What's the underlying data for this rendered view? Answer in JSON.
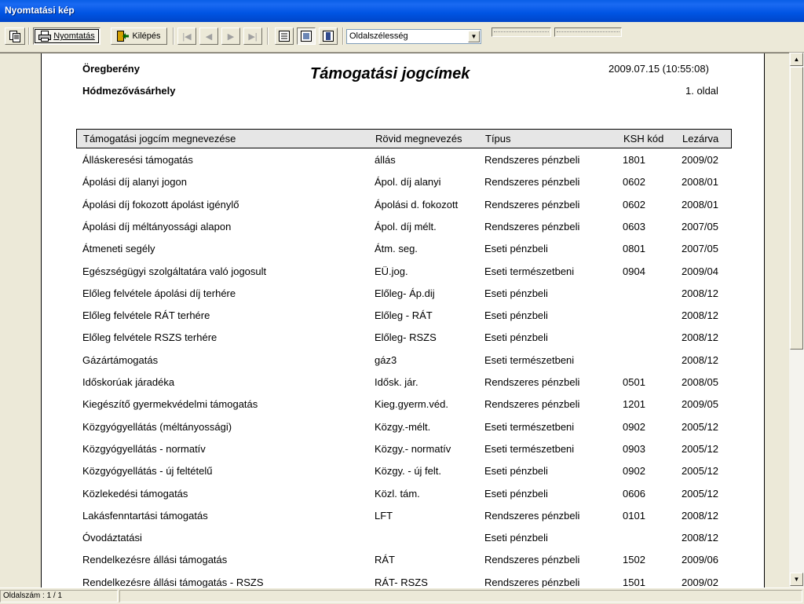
{
  "window": {
    "title": "Nyomtatási kép"
  },
  "toolbar": {
    "print_label": "Nyomtatás",
    "exit_label": "Kilépés",
    "zoom_value": "Oldalszélesség"
  },
  "report": {
    "org_line1": "Öregberény",
    "org_line2": "Hódmezővásárhely",
    "title": "Támogatási jogcímek",
    "datetime": "2009.07.15 (10:55:08)",
    "page": "1. oldal",
    "columns": [
      "Támogatási jogcím megnevezése",
      "Rövid megnevezés",
      "Típus",
      "KSH kód",
      "Lezárva"
    ],
    "rows": [
      [
        "Álláskeresési támogatás",
        "állás",
        "Rendszeres pénzbeli",
        "1801",
        "2009/02"
      ],
      [
        "Ápolási díj alanyi jogon",
        "Ápol. díj alanyi",
        "Rendszeres pénzbeli",
        "0602",
        "2008/01"
      ],
      [
        "Ápolási díj fokozott ápolást igénylő",
        "Ápolási d. fokozott",
        "Rendszeres pénzbeli",
        "0602",
        "2008/01"
      ],
      [
        "Ápolási díj méltányossági alapon",
        "Ápol. díj mélt.",
        "Rendszeres pénzbeli",
        "0603",
        "2007/05"
      ],
      [
        "Átmeneti segély",
        "Átm. seg.",
        "Eseti pénzbeli",
        "0801",
        "2007/05"
      ],
      [
        "Egészségügyi szolgáltatára való jogosult",
        "EÜ.jog.",
        "Eseti természetbeni",
        "0904",
        "2009/04"
      ],
      [
        "Előleg felvétele ápolási díj terhére",
        "Előleg- Áp.dij",
        "Eseti pénzbeli",
        "",
        "2008/12"
      ],
      [
        "Előleg felvétele RÁT terhére",
        "Előleg - RÁT",
        "Eseti pénzbeli",
        "",
        "2008/12"
      ],
      [
        "Előleg felvétele RSZS terhére",
        "Előleg- RSZS",
        "Eseti pénzbeli",
        "",
        "2008/12"
      ],
      [
        "Gázártámogatás",
        "gáz3",
        "Eseti természetbeni",
        "",
        "2008/12"
      ],
      [
        "Időskorúak járadéka",
        "Idősk. jár.",
        "Rendszeres pénzbeli",
        "0501",
        "2008/05"
      ],
      [
        "Kiegészítő gyermekvédelmi támogatás",
        "Kieg.gyerm.véd.",
        "Rendszeres pénzbeli",
        "1201",
        "2009/05"
      ],
      [
        "Közgyógyellátás (méltányossági)",
        "Közgy.-mélt.",
        "Eseti természetbeni",
        "0902",
        "2005/12"
      ],
      [
        "Közgyógyellátás - normatív",
        "Közgy.- normatív",
        "Eseti természetbeni",
        "0903",
        "2005/12"
      ],
      [
        "Közgyógyellátás - új feltételű",
        "Közgy. - új felt.",
        "Eseti pénzbeli",
        "0902",
        "2005/12"
      ],
      [
        "Közlekedési támogatás",
        "Közl. tám.",
        "Eseti pénzbeli",
        "0606",
        "2005/12"
      ],
      [
        "Lakásfenntartási támogatás",
        "LFT",
        "Rendszeres pénzbeli",
        "0101",
        "2008/12"
      ],
      [
        "Óvodáztatási",
        "",
        "Eseti pénzbeli",
        "",
        "2008/12"
      ],
      [
        "Rendelkezésre állási támogatás",
        "RÁT",
        "Rendszeres pénzbeli",
        "1502",
        "2009/06"
      ],
      [
        "Rendelkezésre állási támogatás - RSZS",
        "RÁT- RSZS",
        "Rendszeres pénzbeli",
        "1501",
        "2009/02"
      ]
    ]
  },
  "status": {
    "page_count": "Oldalszám : 1 / 1"
  }
}
